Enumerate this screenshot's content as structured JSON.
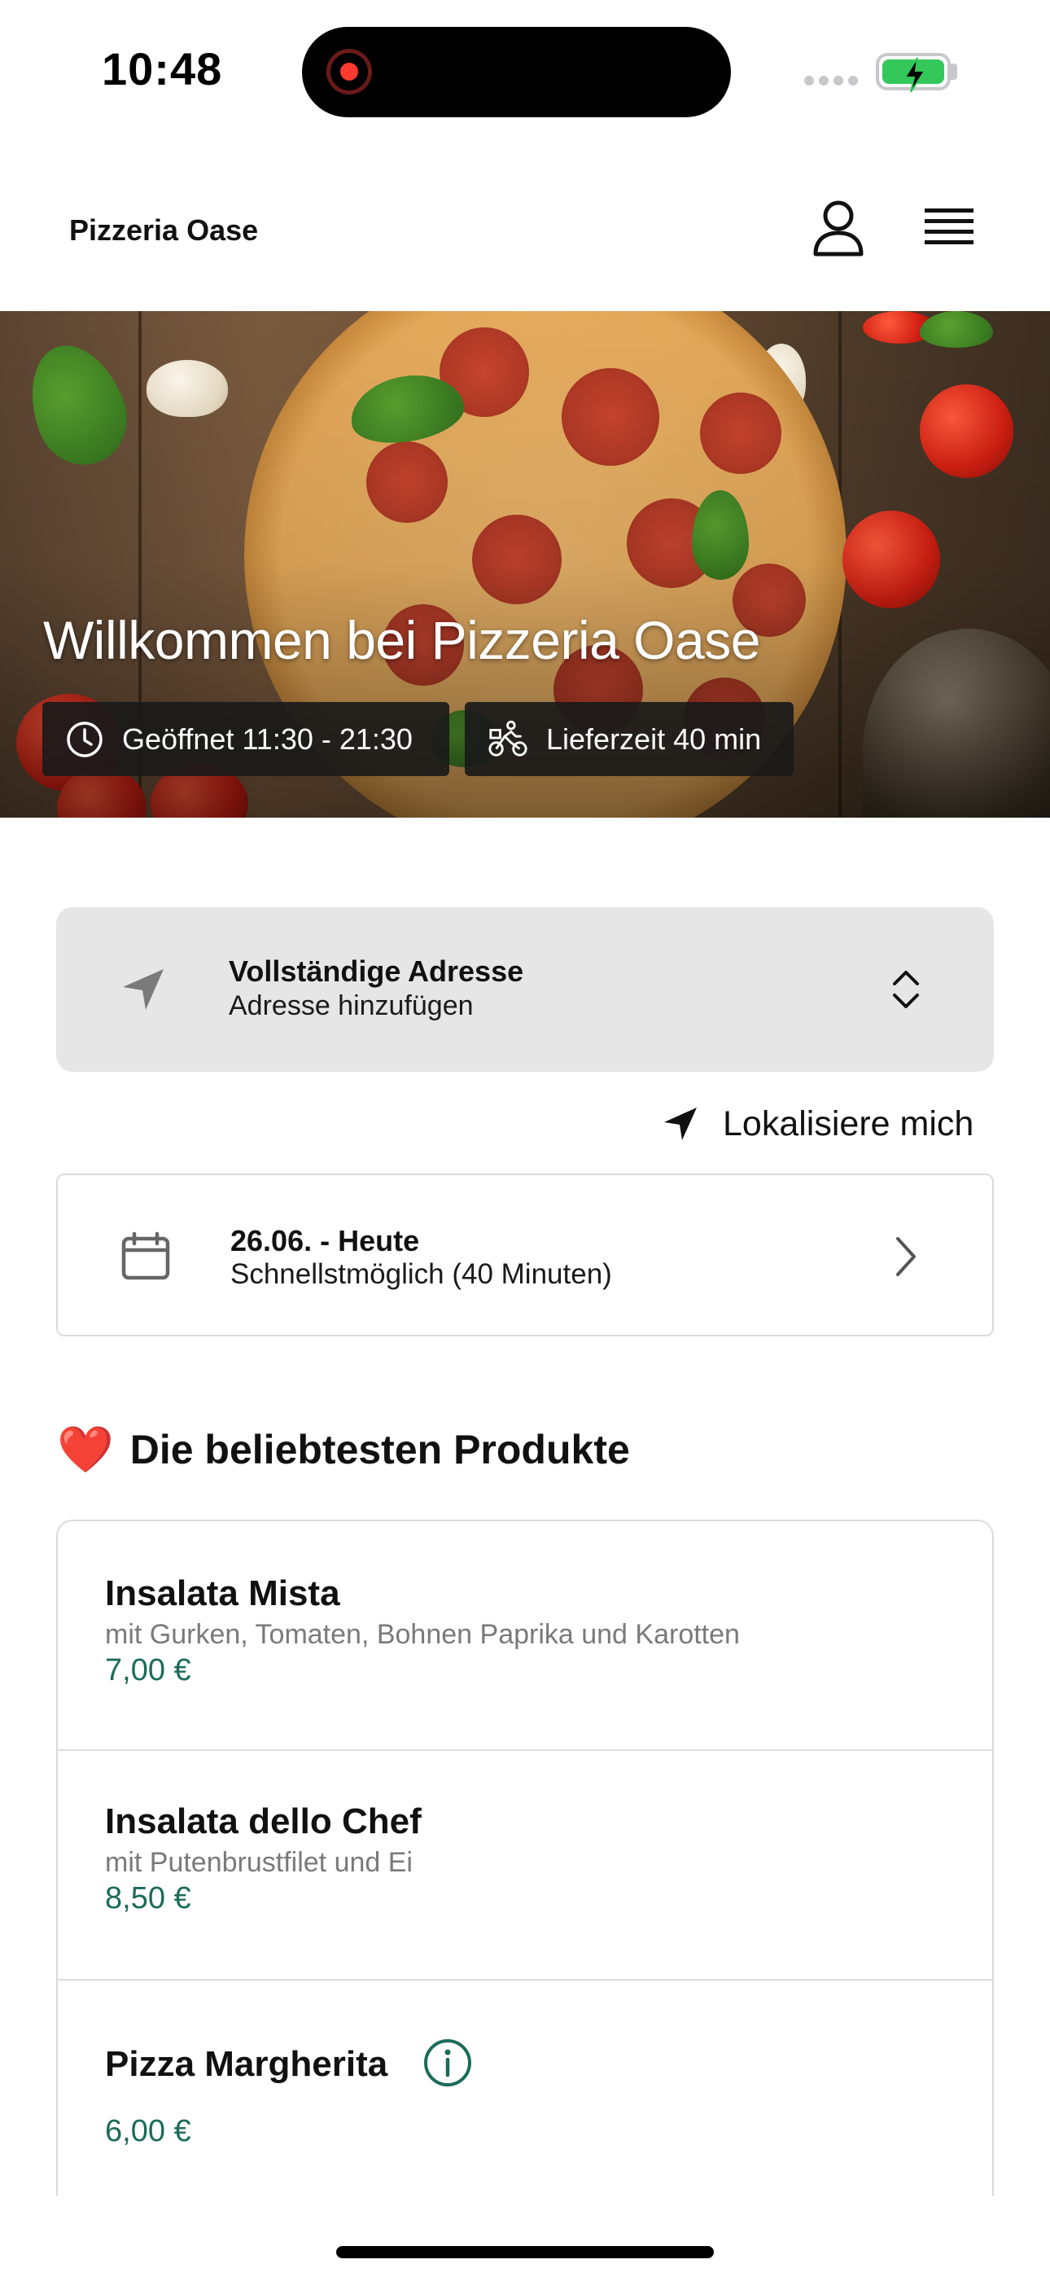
{
  "status_bar": {
    "time": "10:48"
  },
  "header": {
    "brand": "Pizzeria Oase",
    "icons": [
      "user-icon",
      "hamburger-menu-icon"
    ]
  },
  "hero": {
    "title": "Willkommen bei Pizzeria Oase",
    "opening_hours": "Geöffnet 11:30 - 21:30",
    "delivery_time": "Lieferzeit 40 min"
  },
  "address": {
    "title": "Vollständige Adresse",
    "placeholder": "Adresse hinzufügen"
  },
  "locate": {
    "label": "Lokalisiere mich"
  },
  "delivery_date": {
    "title": "26.06. - Heute",
    "subtitle": "Schnellstmöglich (40 Minuten)"
  },
  "section": {
    "emoji": "❤️",
    "title": "Die beliebtesten Produkte"
  },
  "products": [
    {
      "name": "Insalata Mista",
      "description": "mit Gurken, Tomaten, Bohnen Paprika und Karotten",
      "price": "7,00 €"
    },
    {
      "name": "Insalata dello Chef",
      "description": "mit Putenbrustfilet und Ei",
      "price": "8,50 €"
    },
    {
      "name": "Pizza Margherita",
      "price": "6,00 €"
    }
  ],
  "colors": {
    "price": "#1c6b5a",
    "address_background": "#e6e6e6",
    "badge_background": "#1a1a1a",
    "heart": "#e02424"
  }
}
